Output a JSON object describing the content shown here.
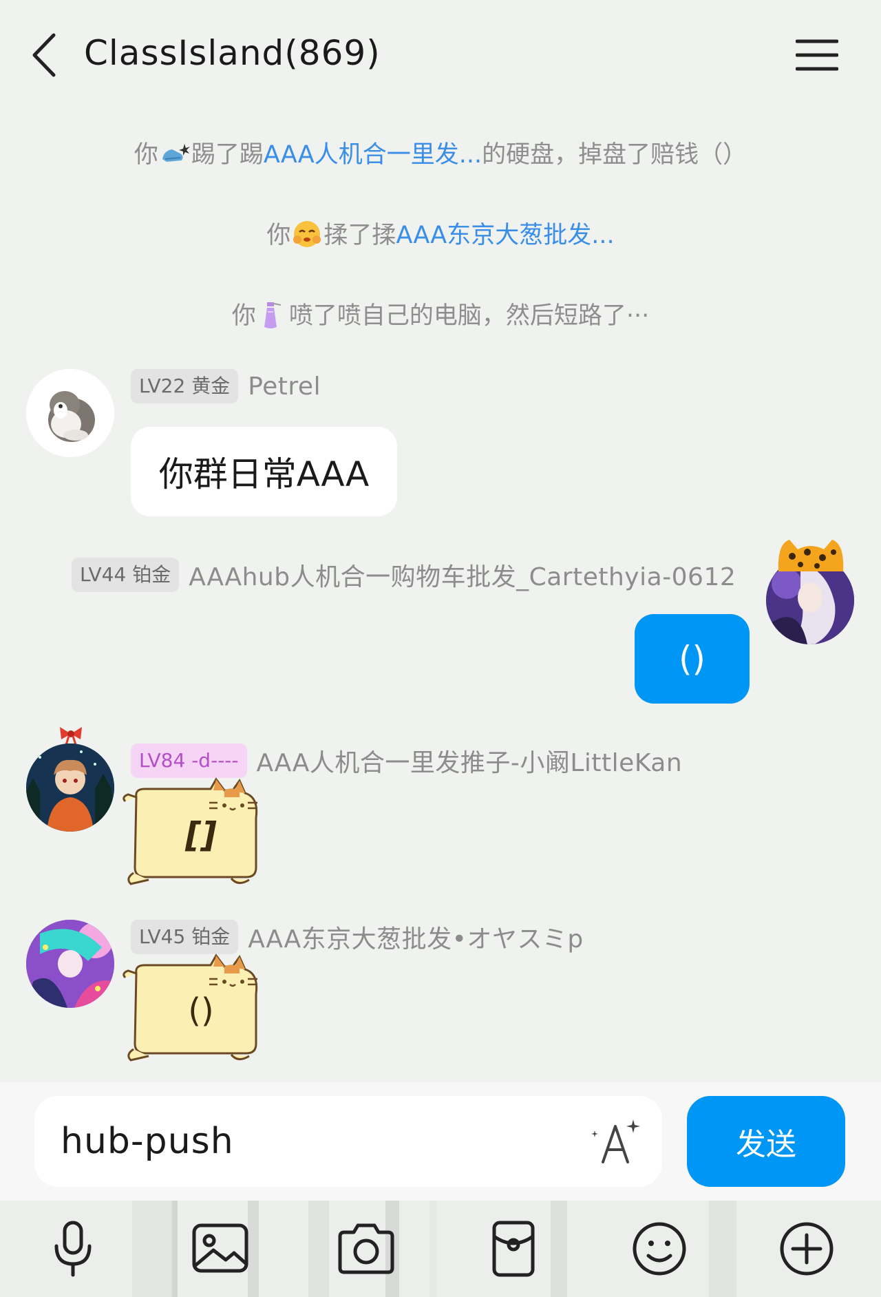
{
  "header": {
    "title": "ClassIsland(869)"
  },
  "notices": [
    {
      "pre": "你",
      "mid": "踢了踢",
      "link": "AAA人机合一里发...",
      "post": "的硬盘，掉盘了赔钱（）",
      "emoji": "kick-icon"
    },
    {
      "pre": "你",
      "mid": "揉了揉",
      "link": "AAA东京大葱批发...",
      "post": "",
      "emoji": "pinch-face-icon"
    },
    {
      "pre": "你",
      "mid": "喷了喷自己的电脑，然后短路了···",
      "link": "",
      "post": "",
      "emoji": "spray-bottle-icon"
    }
  ],
  "messages": [
    {
      "level": "LV22 黄金",
      "name": "Petrel",
      "text": "你群日常AAA"
    },
    {
      "level": "LV44 铂金",
      "name": "AAAhub人机合一购物车批发_Cartethyia-0612",
      "text": "()"
    },
    {
      "level": "LV84 -d----",
      "name": "AAA人机合一里发推子-小阚LittleKan",
      "sticker_text": "[]"
    },
    {
      "level": "LV45 铂金",
      "name": "AAA东京大葱批发•オヤスミp",
      "sticker_text": "()"
    }
  ],
  "composer": {
    "input_value": "hub-push",
    "send_label": "发送"
  },
  "colors": {
    "background": "#f0f2ef",
    "accent": "#0096f6",
    "link": "#3a8ee8"
  }
}
